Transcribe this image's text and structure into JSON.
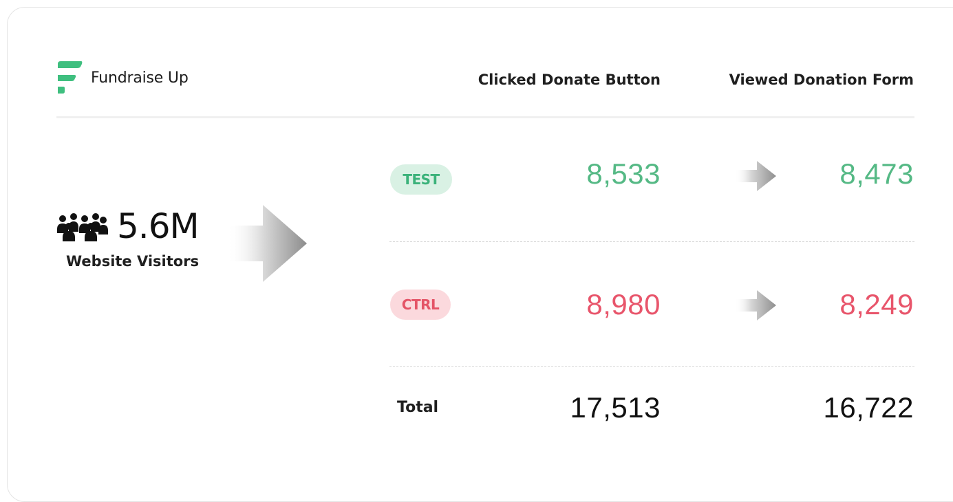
{
  "brand": {
    "name": "Fundraise Up",
    "accent_color": "#3fbf7f"
  },
  "headers": {
    "clicked": "Clicked Donate Button",
    "viewed": "Viewed Donation Form"
  },
  "visitors": {
    "icon": "people-group-icon",
    "value": "5.6M",
    "label": "Website Visitors"
  },
  "rows": {
    "test": {
      "badge": "TEST",
      "clicked": "8,533",
      "viewed": "8,473",
      "color": "#55b985"
    },
    "ctrl": {
      "badge": "CTRL",
      "clicked": "8,980",
      "viewed": "8,249",
      "color": "#e8556b"
    },
    "total": {
      "label": "Total",
      "clicked": "17,513",
      "viewed": "16,722"
    }
  }
}
